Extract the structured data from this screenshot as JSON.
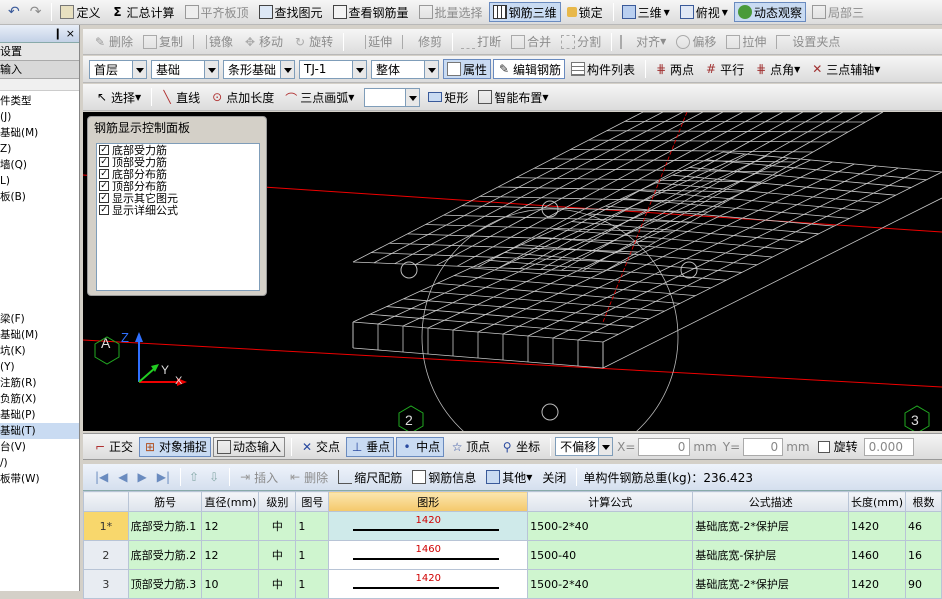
{
  "toolbar1": {
    "undo": "↶",
    "redo": "↷",
    "items": [
      "定义",
      "汇总计算",
      "平齐板顶",
      "查找图元",
      "查看钢筋量",
      "批量选择",
      "钢筋三维",
      "锁定"
    ],
    "view_mode": "三维",
    "view_dir": "俯视",
    "dynamic": "动态观察",
    "local": "局部三"
  },
  "toolbar2": {
    "items": [
      "删除",
      "复制",
      "镜像",
      "移动",
      "旋转",
      "延伸",
      "修剪",
      "打断",
      "合并",
      "分割",
      "对齐",
      "偏移",
      "拉伸",
      "设置夹点"
    ]
  },
  "toolbar3": {
    "floor": "首层",
    "category": "基础",
    "type": "条形基础",
    "element": "TJ-1",
    "scope": "整体",
    "prop": "属性",
    "edit_rebar": "编辑钢筋",
    "member_list": "构件列表",
    "twopoint": "两点",
    "parallel": "平行",
    "angle": "点角",
    "threepoint_aux": "三点辅轴"
  },
  "toolbar4": {
    "select": "选择",
    "line": "直线",
    "point_len": "点加长度",
    "arc": "三点画弧",
    "arc_value": "",
    "rect": "矩形",
    "smart": "智能布置"
  },
  "left": {
    "pin": "❙ ×",
    "tab1": "设置",
    "tab2": "输入",
    "items_top": [
      "件类型",
      "(J)",
      "基础(M)",
      "Z)",
      "墙(Q)",
      "L)",
      "板(B)"
    ],
    "items_bottom": [
      "梁(F)",
      "基础(M)",
      "坑(K)",
      "(Y)",
      "注筋(R)",
      "负筋(X)",
      "基础(P)",
      "基础(T)",
      "台(V)",
      "/)",
      "板带(W)"
    ]
  },
  "control_panel": {
    "title": "钢筋显示控制面板",
    "options": [
      {
        "label": "底部受力筋",
        "checked": true
      },
      {
        "label": "顶部受力筋",
        "checked": true
      },
      {
        "label": "底部分布筋",
        "checked": true
      },
      {
        "label": "顶部分布筋",
        "checked": true
      },
      {
        "label": "显示其它图元",
        "checked": true
      },
      {
        "label": "显示详细公式",
        "checked": true
      }
    ]
  },
  "viewport": {
    "axis_labels": [
      "A",
      "2",
      "3"
    ],
    "gizmo": {
      "z": "Z",
      "y": "Y",
      "x": "X"
    }
  },
  "snapbar": {
    "ortho": "正交",
    "snap": "对象捕捉",
    "dyn_input": "动态输入",
    "cross": "交点",
    "perp": "垂点",
    "mid": "中点",
    "vertex": "顶点",
    "coord": "坐标",
    "offset": "不偏移",
    "x_label": "X=",
    "x_value": "0",
    "unit1": "mm",
    "y_label": "Y=",
    "y_value": "0",
    "unit2": "mm",
    "rotate": "旋转",
    "rotate_value": "0.000"
  },
  "gridbar": {
    "insert": "插入",
    "delete": "删除",
    "scale": "缩尺配筋",
    "info": "钢筋信息",
    "other": "其他",
    "close": "关闭",
    "total": "单构件钢筋总重(kg)：236.423"
  },
  "table": {
    "headers": [
      "筋号",
      "直径(mm)",
      "级别",
      "图号",
      "图形",
      "计算公式",
      "公式描述",
      "长度(mm)",
      "根数"
    ],
    "rows": [
      {
        "no": "1*",
        "name": "底部受力筋.1",
        "dia": "12",
        "grade": "中",
        "fig_no": "1",
        "shape": "1420",
        "formula": "1500-2*40",
        "desc": "基础底宽-2*保护层",
        "len": "1420",
        "count": "46"
      },
      {
        "no": "2",
        "name": "底部受力筋.2",
        "dia": "12",
        "grade": "中",
        "fig_no": "1",
        "shape": "1460",
        "formula": "1500-40",
        "desc": "基础底宽-保护层",
        "len": "1460",
        "count": "16"
      },
      {
        "no": "3",
        "name": "顶部受力筋.3",
        "dia": "10",
        "grade": "中",
        "fig_no": "1",
        "shape": "1420",
        "formula": "1500-2*40",
        "desc": "基础底宽-2*保护层",
        "len": "1420",
        "count": "90"
      }
    ]
  }
}
